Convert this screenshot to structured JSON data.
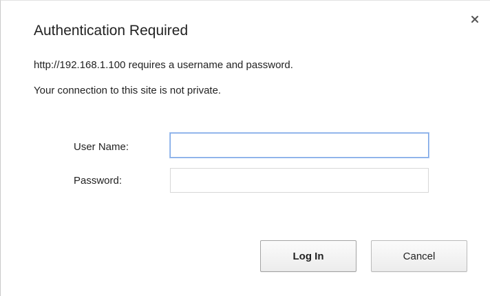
{
  "dialog": {
    "title": "Authentication Required",
    "message_line1": "http://192.168.1.100 requires a username and password.",
    "message_line2": "Your connection to this site is not private.",
    "close_icon": "close-icon"
  },
  "form": {
    "username_label": "User Name:",
    "username_value": "",
    "password_label": "Password:",
    "password_value": ""
  },
  "buttons": {
    "login_label": "Log In",
    "cancel_label": "Cancel"
  },
  "colors": {
    "focus_border": "#7ba6e6",
    "text": "#222222"
  }
}
